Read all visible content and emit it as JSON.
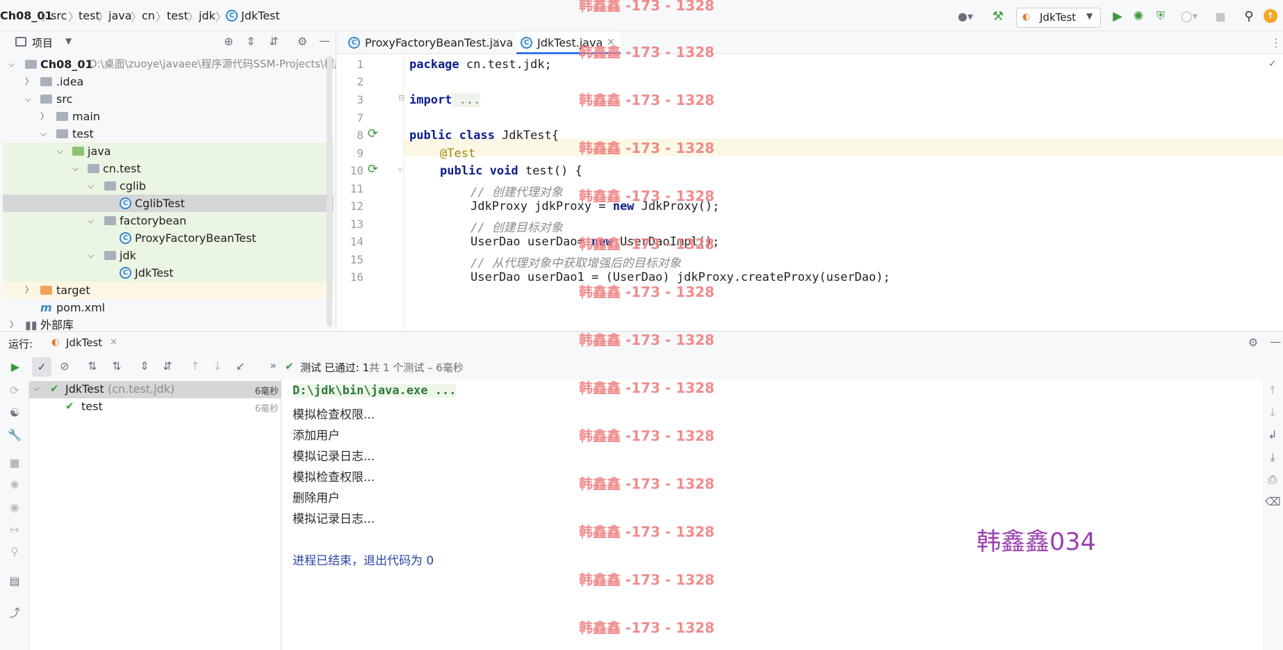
{
  "breadcrumb": [
    "Ch08_01",
    "src",
    "test",
    "java",
    "cn",
    "test",
    "jdk",
    "JdkTest"
  ],
  "toolbar": {
    "run_config": "JdkTest",
    "icons": [
      "user-icon",
      "hammer-icon",
      "run-icon",
      "debug-icon",
      "coverage-icon",
      "profile-icon",
      "stop-icon",
      "search-icon",
      "update-icon"
    ]
  },
  "project": {
    "header_label": "项目",
    "root_name": "Ch08_01",
    "root_path": "D:\\桌面\\zuoye\\javaee\\程序源代码SSM-Projects\\程序",
    "items": [
      {
        "label": ".idea"
      },
      {
        "label": "src"
      },
      {
        "label": "main"
      },
      {
        "label": "test"
      },
      {
        "label": "java"
      },
      {
        "label": "cn.test"
      },
      {
        "label": "cglib"
      },
      {
        "label": "CglibTest"
      },
      {
        "label": "factorybean"
      },
      {
        "label": "ProxyFactoryBeanTest"
      },
      {
        "label": "jdk"
      },
      {
        "label": "JdkTest"
      },
      {
        "label": "target"
      },
      {
        "label": "pom.xml"
      },
      {
        "label": "外部库"
      }
    ]
  },
  "editor": {
    "tabs": [
      {
        "label": "ProxyFactoryBeanTest.java"
      },
      {
        "label": "JdkTest.java"
      }
    ],
    "line_numbers": [
      "1",
      "2",
      "3",
      "7",
      "8",
      "9",
      "10",
      "11",
      "12",
      "13",
      "14",
      "15",
      "16"
    ],
    "lines": {
      "l1_kw": "package",
      "l1_rest": " cn.test.jdk;",
      "l3_kw": "import",
      "l3_rest": " ...",
      "l8_kw": "public class",
      "l8_rest": " JdkTest{",
      "l9": "@Test",
      "l10_kw": "public void",
      "l10_rest": " test() {",
      "l11": "// 创建代理对象",
      "l12_a": "JdkProxy jdkProxy = ",
      "l12_kw": "new",
      "l12_b": " JdkProxy();",
      "l13": "// 创建目标对象",
      "l14_a": "UserDao userDao= ",
      "l14_kw": "new",
      "l14_b": " UserDaoImpl();",
      "l15": "// 从代理对象中获取增强后的目标对象",
      "l16": "UserDao userDao1 = (UserDao) jdkProxy.createProxy(userDao);"
    }
  },
  "run": {
    "label": "运行:",
    "tab": "JdkTest",
    "status_prefix": "测试 已通过:",
    "status_count": "1",
    "status_rest": "共 1 个测试 – 6毫秒",
    "tree": [
      {
        "name": "JdkTest",
        "pkg": "(cn.test.jdk)",
        "time": "6毫秒"
      },
      {
        "name": "test",
        "pkg": "",
        "time": "6毫秒"
      }
    ],
    "console": {
      "cmd": "D:\\jdk\\bin\\java.exe ...",
      "lines": [
        "模拟检查权限...",
        "添加用户",
        "模拟记录日志...",
        "模拟检查权限...",
        "删除用户",
        "模拟记录日志..."
      ],
      "exit": "进程已结束，退出代码为 0"
    }
  },
  "watermark": {
    "text": "韩鑫鑫 -173 - 1328",
    "signature": "韩鑫鑫034"
  },
  "colors": {
    "keyword": "#0b1d8c",
    "comment": "#8c8c8c",
    "annotation": "#9e880d",
    "pass_green": "#3b9f3b",
    "watermark": "#f08080",
    "signature": "#9a3fb0"
  }
}
